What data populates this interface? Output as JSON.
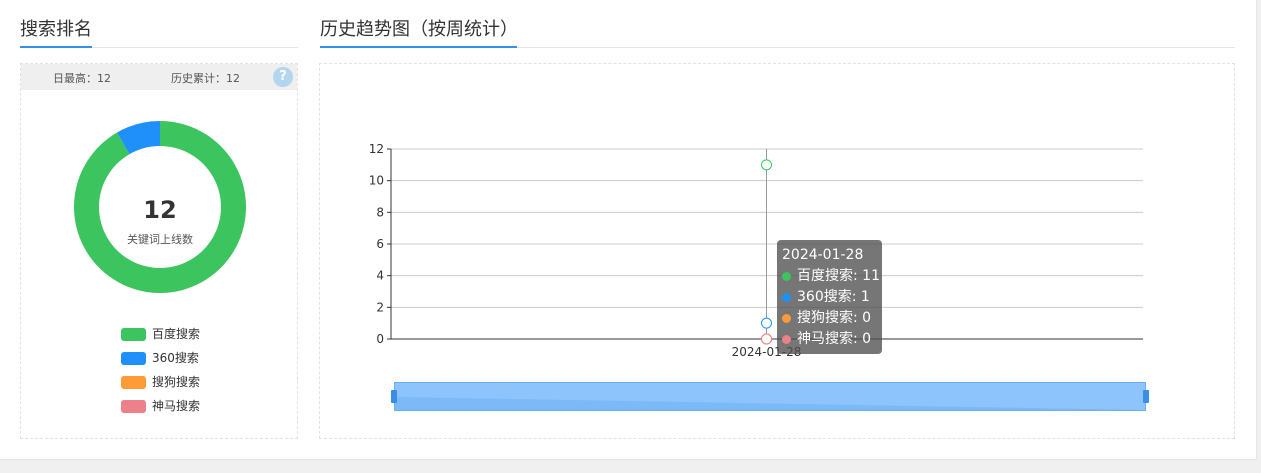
{
  "left": {
    "title": "搜索排名",
    "stats": {
      "daily_max": "日最高：12",
      "history_total": "历史累计：12"
    },
    "help_glyph": "?",
    "donut": {
      "center_value": "12",
      "center_label": "关键词上线数"
    }
  },
  "right": {
    "title": "历史趋势图（按周统计）"
  },
  "colors": {
    "baidu": "#3cc45f",
    "s360": "#1f8ffa",
    "sogou": "#ff9a38",
    "shenma": "#ec8189",
    "accent": "#3a8ee6"
  },
  "tooltip": {
    "date": "2024-01-28",
    "rows": [
      {
        "label": "百度搜索: 11"
      },
      {
        "label": "360搜索: 1"
      },
      {
        "label": "搜狗搜索: 0"
      },
      {
        "label": "神马搜索: 0"
      }
    ]
  },
  "chart_data": [
    {
      "type": "pie",
      "categories": [
        "百度搜索",
        "360搜索",
        "搜狗搜索",
        "神马搜索"
      ],
      "values": [
        11,
        1,
        0,
        0
      ],
      "title": "",
      "legend": "bottom"
    },
    {
      "type": "line",
      "x": [
        "2024-01-28"
      ],
      "series": [
        {
          "name": "百度搜索",
          "values": [
            11
          ]
        },
        {
          "name": "360搜索",
          "values": [
            1
          ]
        },
        {
          "name": "搜狗搜索",
          "values": [
            0
          ]
        },
        {
          "name": "神马搜索",
          "values": [
            0
          ]
        }
      ],
      "yticks": [
        0,
        2,
        4,
        6,
        8,
        10,
        12
      ],
      "ylim": [
        0,
        12
      ],
      "xlabel": "",
      "ylabel": "",
      "grid": true,
      "title": ""
    }
  ]
}
